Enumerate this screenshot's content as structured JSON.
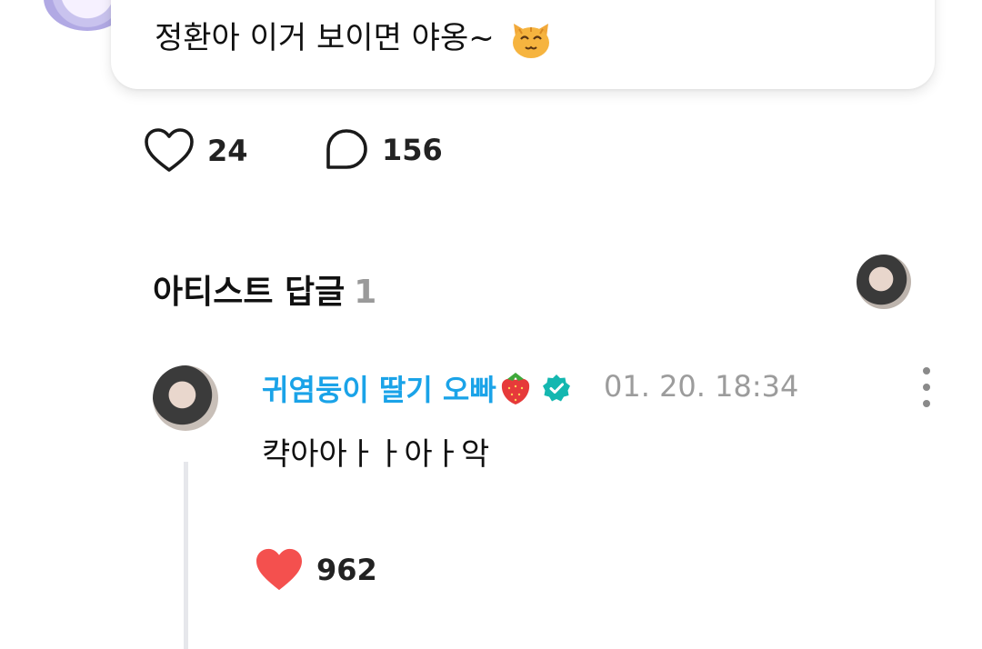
{
  "post": {
    "text": "정환아 이거 보이면 야옹~",
    "emoji": "smiling-cat-emoji",
    "like_count": "24",
    "comment_count": "156"
  },
  "artist_replies": {
    "title": "아티스트 답글",
    "count": "1"
  },
  "reply": {
    "author": "귀염둥이 딸기 오빠",
    "author_emoji": "strawberry-emoji",
    "verified": true,
    "timestamp": "01. 20. 18:34",
    "text": "캭아아ㅏㅏ아ㅏ악",
    "like_count": "962"
  },
  "colors": {
    "accent_blue": "#1aa3e8",
    "verified_teal": "#14b7b0",
    "heart_red": "#f4504e",
    "muted_gray": "#9c9c9c"
  }
}
